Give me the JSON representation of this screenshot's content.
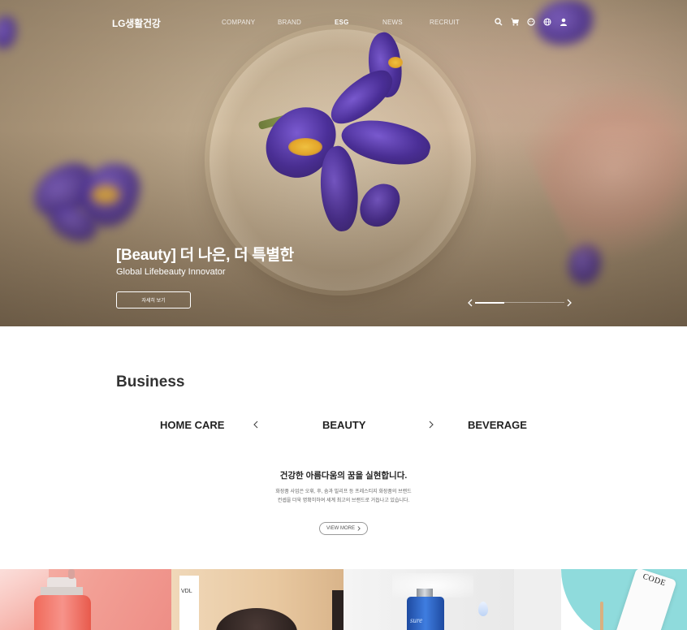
{
  "nav": {
    "logo": "LG생활건강",
    "menu": [
      "COMPANY",
      "BRAND",
      "ESG",
      "NEWS",
      "RECRUIT"
    ],
    "active": "ESG",
    "icons": [
      "search-icon",
      "cart-icon",
      "chat-icon",
      "globe-icon",
      "user-icon"
    ]
  },
  "hero": {
    "title": "[Beauty] 더 나은, 더 특별한",
    "subtitle": "Global Lifebeauty Innovator",
    "button": "자세히 보기",
    "slider_progress": 0.33
  },
  "business": {
    "title": "Business",
    "categories": [
      "HOME CARE",
      "BEAUTY",
      "BEVERAGE"
    ],
    "active_category": "BEAUTY",
    "headline": "건강한 아름다움의 꿈을 실현합니다.",
    "desc_line1": "화장품 사업은 오휘, 후, 숨과 빌리프 등 프레스티지 화장품의 브랜드",
    "desc_line2": "컨셉을 더욱 명확히하여 세계 최고의 브랜드로 거듭나고 있습니다.",
    "view_more": "VIEW MORE"
  },
  "products": {
    "p2_brand": "VDL",
    "p3_brand": "sure",
    "p4_brand": "CODE"
  }
}
